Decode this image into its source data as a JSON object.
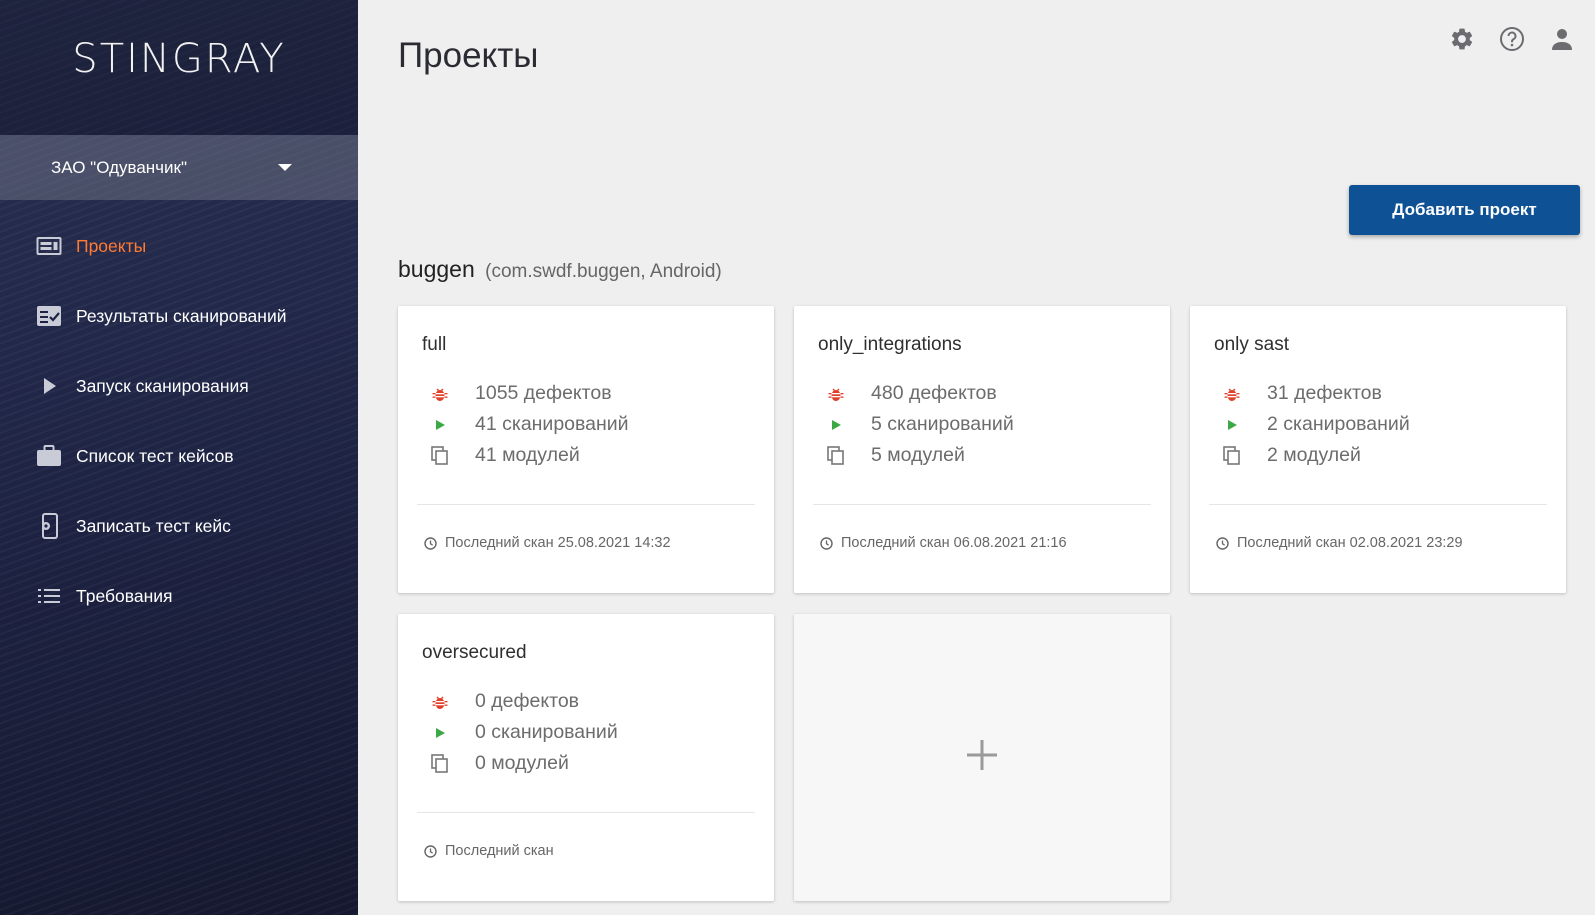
{
  "app": {
    "logo": "STINGRAY"
  },
  "sidebar": {
    "org": "ЗАО \"Одуванчик\"",
    "items": [
      {
        "label": "Проекты",
        "icon": "projects-icon",
        "active": true
      },
      {
        "label": "Результаты сканирований",
        "icon": "scan-results-icon"
      },
      {
        "label": "Запуск сканирования",
        "icon": "play-icon"
      },
      {
        "label": "Список тест кейсов",
        "icon": "briefcase-icon"
      },
      {
        "label": "Записать тест кейс",
        "icon": "record-device-icon"
      },
      {
        "label": "Требования",
        "icon": "list-icon"
      }
    ]
  },
  "header": {
    "title": "Проекты",
    "icons": [
      "gear-icon",
      "help-icon",
      "user-icon"
    ]
  },
  "actions": {
    "add_project": "Добавить проект"
  },
  "group": {
    "name": "buggen",
    "subtitle": "(com.swdf.buggen, Android)"
  },
  "projects": [
    {
      "name": "full",
      "defects": "1055 дефектов",
      "scans": "41 сканирований",
      "modules": "41 модулей",
      "last_scan": "Последний скан 25.08.2021 14:32"
    },
    {
      "name": "only_integrations",
      "defects": "480 дефектов",
      "scans": "5 сканирований",
      "modules": "5 модулей",
      "last_scan": "Последний скан 06.08.2021 21:16"
    },
    {
      "name": "only sast",
      "defects": "31 дефектов",
      "scans": "2 сканирований",
      "modules": "2 модулей",
      "last_scan": "Последний скан 02.08.2021 23:29"
    },
    {
      "name": "oversecured",
      "defects": "0 дефектов",
      "scans": "0 сканирований",
      "modules": "0 модулей",
      "last_scan": "Последний скан"
    }
  ],
  "colors": {
    "accent": "#ff7a33",
    "primary_button": "#0f5195",
    "bug": "#e0402a",
    "play": "#3aa845"
  }
}
